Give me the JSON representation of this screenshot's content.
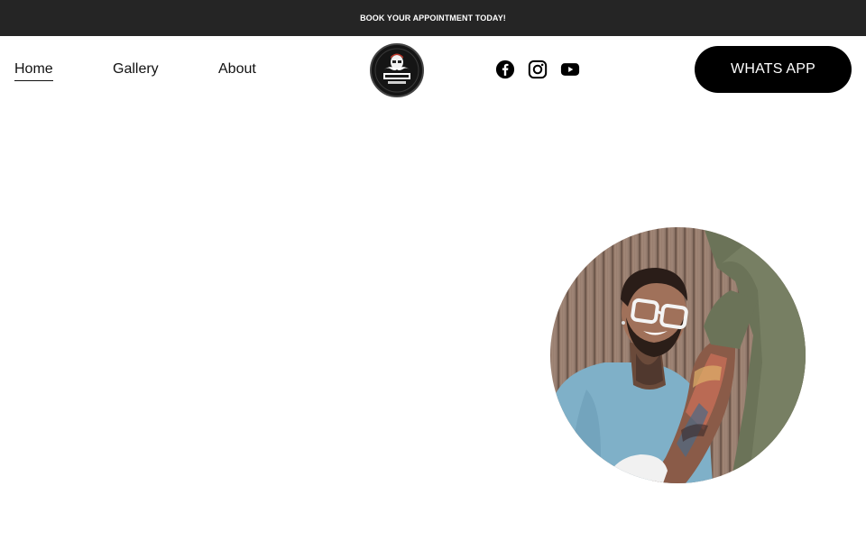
{
  "announcement": {
    "text": "BOOK YOUR APPOINTMENT TODAY!"
  },
  "nav": {
    "items": [
      {
        "label": "Home",
        "active": true
      },
      {
        "label": "Gallery",
        "active": false
      },
      {
        "label": "About",
        "active": false
      }
    ]
  },
  "logo": {
    "icon": "mustache-logo",
    "text": "MUSTACHE"
  },
  "social": [
    {
      "icon": "facebook-icon"
    },
    {
      "icon": "instagram-icon"
    },
    {
      "icon": "youtube-icon"
    }
  ],
  "cta": {
    "label": "WHATS APP"
  },
  "colors": {
    "topbar": "#252525",
    "button": "#000000",
    "text": "#111111"
  }
}
